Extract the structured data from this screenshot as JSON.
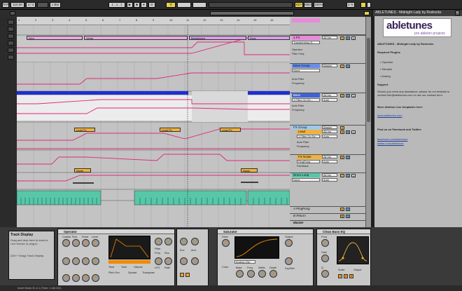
{
  "topbar": {
    "tap_label": "TAP",
    "tempo": "110.00",
    "sig": "4 / 4",
    "bar_display": "1 Bar",
    "pos": "1 . 1 . 1",
    "key_label": "KEY",
    "midi_label": "MIDI",
    "zoom": "100%",
    "cpu": "4 %",
    "ovr_label": "D"
  },
  "ruler": {
    "marks": [
      "1",
      "2",
      "3",
      "4",
      "5",
      "6",
      "7",
      "8",
      "9",
      "10",
      "11",
      "12",
      "13",
      "14",
      "15",
      "16"
    ]
  },
  "clips": [
    {
      "label": "Intro"
    },
    {
      "label": "Verse"
    },
    {
      "label": "Breakdown"
    },
    {
      "label": "Drop"
    },
    {
      "label": "Lead Pc"
    },
    {
      "label": "Lead Pc"
    },
    {
      "label": "Lead Pc"
    },
    {
      "label": "Noise"
    },
    {
      "label": "Noise"
    }
  ],
  "tracks": [
    {
      "name": "1 FX Sweep/Impact",
      "param": "Transforming S...",
      "p1": "Operator",
      "p2": "Filter Freq",
      "route": "All Ins",
      "mon": "In",
      "color": "#e78ad8"
    },
    {
      "name": "Bass Group",
      "param": "None",
      "p1": "Auto Filter",
      "p2": "Frequency",
      "route": "Master",
      "mon": "In",
      "color": "#6a8de8"
    },
    {
      "name": "Bass",
      "param": "1 Filter On Se...",
      "p1": "Auto Filter",
      "p2": "Frequency",
      "route": "All Ins",
      "mon": "Auto",
      "color": "#3f63d6"
    },
    {
      "name": "FX Group",
      "param": "None",
      "p1": "",
      "p2": "",
      "route": "Master",
      "mon": "In",
      "color": "#9ec9ee"
    },
    {
      "name": "Lead",
      "param": "1 Filter On Se...",
      "p1": "Auto Filter",
      "p2": "Frequency",
      "route": "All Ins",
      "mon": "Auto",
      "color": "#f1b23b"
    },
    {
      "name": "FX Noise",
      "param": "PingPong",
      "p1": "Feedback",
      "p2": "",
      "route": "All Ins",
      "mon": "Auto",
      "color": "#f1b23b"
    },
    {
      "name": "Drum Loop",
      "param": "None",
      "p1": "",
      "p2": "",
      "route": "All Ins",
      "mon": "Auto",
      "color": "#56c7a8"
    },
    {
      "name": "A PingPong",
      "param": "",
      "p1": "",
      "p2": "",
      "route": "",
      "mon": "",
      "color": "#bdbdbd"
    },
    {
      "name": "B Return",
      "param": "",
      "p1": "",
      "p2": "",
      "route": "",
      "mon": "",
      "color": "#bdbdbd"
    },
    {
      "name": "Master",
      "param": "",
      "p1": "",
      "p2": "",
      "route": "",
      "mon": "",
      "color": "#bdbdbd"
    }
  ],
  "right_panel": {
    "title": "ABLETUNES - Midnight Lady by Rodrocks",
    "logo_main": "abletunes",
    "logo_sub": "pro ableton projects",
    "heading": "ABLETUNES - Midnight Lady by Rodrocks",
    "req_title": "Required Plugins",
    "plugins": [
      "• Operator",
      "• Sampler",
      "• Analog"
    ],
    "support_title": "Support",
    "support_text": "Should you need any assistance, please do not hesitate to contact info@abletunes.com or use our contact form.",
    "more_text": "More Ableton Live templates here:",
    "site": "www.abletunes.com",
    "social_title": "Find us on Facebook and Twitter:",
    "fb": "facebook.com/abletunes",
    "tw": "twitter.com/abletunes"
  },
  "track_display": {
    "title": "Track Display",
    "text": "Drag and drop here to insert a Live Device or plug-in.",
    "hint": "(Ctrl + Drag) Track Display"
  },
  "devices": {
    "operator": {
      "title": "Operator",
      "labels": [
        "Coarse",
        "Fine",
        "Fixed",
        "Level",
        "Filter",
        "Freq",
        "Res",
        "Env",
        "LFO",
        "Rate",
        "Amt",
        "Time",
        "Tone",
        "Volume",
        "Pitch Env",
        "Spread",
        "Transpose"
      ]
    },
    "saturator": {
      "title": "Saturator",
      "labels": [
        "Drive",
        "Output",
        "Dry/Wet",
        "Analog Clip",
        "Color",
        "Base",
        "Freq",
        "Width",
        "Depth"
      ]
    },
    "eq": {
      "title": "Clean Bass EQ",
      "labels": [
        "Freq",
        "Gain",
        "Q",
        "Scale",
        "Output"
      ]
    }
  },
  "status": {
    "text": "Insert Mark 31.4.1 (Time: 1:48.042)"
  }
}
